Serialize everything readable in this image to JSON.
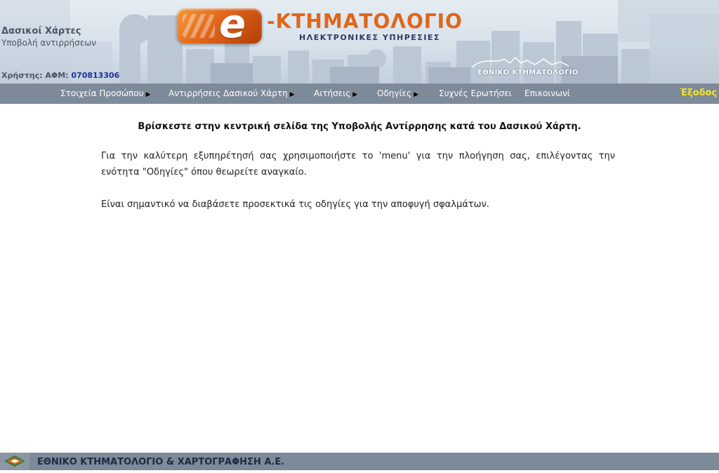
{
  "header": {
    "site_title": "Δασικοί Χάρτες",
    "site_subtitle": "Υποβολή αντιρρήσεων",
    "user_label": "Χρήστης: ΑΦΜ:",
    "user_afm": "070813306",
    "logo_letter": "e",
    "logo_title": "-ΚΤΗΜΑΤΟΛΟΓΙΟ",
    "logo_subtitle": "ΗΛΕΚΤΡΟΝΙΚΕΣ ΥΠΗΡΕΣΙΕΣ",
    "org_logo_text": "ΕΘΝΙΚΟ ΚΤΗΜΑΤΟΛΟΓΙΟ",
    "colors": {
      "brand_orange": "#e0661a",
      "nav_bg": "#7d8a99",
      "exit_yellow": "#f5e623"
    }
  },
  "nav": {
    "items": [
      {
        "label": "Στοιχεία Προσώπου",
        "has_submenu": true
      },
      {
        "label": "Αντιρρήσεις Δασικού Χάρτη",
        "has_submenu": true
      },
      {
        "label": "Αιτήσεις",
        "has_submenu": true
      },
      {
        "label": "Οδηγίες",
        "has_submenu": true
      },
      {
        "label": "Συχνές Ερωτήσει",
        "has_submenu": false
      },
      {
        "label": "Επικοινωνί",
        "has_submenu": false
      }
    ],
    "exit_label": "Έξοδος",
    "submenu_icon": "triangle-right-icon"
  },
  "content": {
    "heading": "Βρίσκεστε στην κεντρική σελίδα της Υποβολής Αντίρρησης κατά του Δασικού Χάρτη.",
    "paragraph1": "Για την καλύτερη εξυπηρέτησή σας χρησιμοποιήστε το 'menu' για την πλοήγηση σας, επιλέγοντας την ενότητα \"Οδηγίες\" όπου θεωρείτε αναγκαίο.",
    "paragraph2": "Είναι σημαντικό να διαβάσετε προσεκτικά τις οδηγίες για την αποφυγή σφαλμάτων."
  },
  "footer": {
    "company": "ΕΘΝΙΚΟ ΚΤΗΜΑΤΟΛΟΓΙΟ & ΧΑΡΤΟΓΡΑΦΗΣΗ Α.Ε."
  }
}
